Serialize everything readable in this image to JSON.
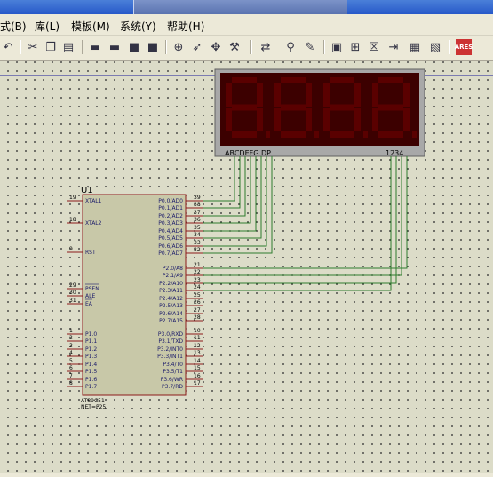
{
  "menu": [
    "式(B)",
    "库(L)",
    "模板(M)",
    "系统(Y)",
    "帮助(H)"
  ],
  "toolbar_icons": [
    "undo-icon",
    "cut-icon",
    "copy-icon",
    "paste-icon",
    "block-copy-icon",
    "block-move-icon",
    "block-rotate-icon",
    "block-delete-icon",
    "zoom-icon",
    "pick-device-icon",
    "make-device-icon",
    "packaging-tool-icon",
    "wire-autorouter-icon",
    "search-tag-icon",
    "property-assign-icon",
    "new-sheet-icon",
    "remove-sheet-icon",
    "goto-sheet-icon",
    "bom-icon",
    "netlist-icon",
    "ares-icon"
  ],
  "component": {
    "ref": "U1",
    "part": "AT89C51",
    "net_label": "NET=P25",
    "left_pins": [
      {
        "num": "19",
        "name": "XTAL1"
      },
      {
        "num": "18",
        "name": "XTAL2"
      },
      {
        "num": "9",
        "name": "RST"
      },
      {
        "num": "29",
        "name": "PSEN"
      },
      {
        "num": "30",
        "name": "ALE"
      },
      {
        "num": "31",
        "name": "EA"
      },
      {
        "num": "1",
        "name": "P1.0"
      },
      {
        "num": "2",
        "name": "P1.1"
      },
      {
        "num": "3",
        "name": "P1.2"
      },
      {
        "num": "4",
        "name": "P1.3"
      },
      {
        "num": "5",
        "name": "P1.4"
      },
      {
        "num": "6",
        "name": "P1.5"
      },
      {
        "num": "7",
        "name": "P1.6"
      },
      {
        "num": "8",
        "name": "P1.7"
      }
    ],
    "right_pins": [
      {
        "num": "39",
        "name": "P0.0/AD0"
      },
      {
        "num": "38",
        "name": "P0.1/AD1"
      },
      {
        "num": "37",
        "name": "P0.2/AD2"
      },
      {
        "num": "36",
        "name": "P0.3/AD3"
      },
      {
        "num": "35",
        "name": "P0.4/AD4"
      },
      {
        "num": "34",
        "name": "P0.5/AD5"
      },
      {
        "num": "33",
        "name": "P0.6/AD6"
      },
      {
        "num": "32",
        "name": "P0.7/AD7"
      },
      {
        "num": "21",
        "name": "P2.0/A8"
      },
      {
        "num": "22",
        "name": "P2.1/A9"
      },
      {
        "num": "23",
        "name": "P2.2/A10"
      },
      {
        "num": "24",
        "name": "P2.3/A11"
      },
      {
        "num": "25",
        "name": "P2.4/A12"
      },
      {
        "num": "26",
        "name": "P2.5/A13"
      },
      {
        "num": "27",
        "name": "P2.6/A14"
      },
      {
        "num": "28",
        "name": "P2.7/A15"
      },
      {
        "num": "10",
        "name": "P3.0/RXD"
      },
      {
        "num": "11",
        "name": "P3.1/TXD"
      },
      {
        "num": "12",
        "name": "P3.2/INT0"
      },
      {
        "num": "13",
        "name": "P3.3/INT1"
      },
      {
        "num": "14",
        "name": "P3.4/T0"
      },
      {
        "num": "15",
        "name": "P3.5/T1"
      },
      {
        "num": "16",
        "name": "P3.6/WR"
      },
      {
        "num": "17",
        "name": "P3.7/RD"
      }
    ]
  },
  "display": {
    "segment_label": "ABCDEFG DP",
    "digit_label": "1234",
    "digits": 4,
    "digit_value": "8",
    "segment_color": "#5a0000",
    "background_color": "#3c0000"
  },
  "colors": {
    "wire": "#2e7d2e",
    "pin": "#8b1a1a",
    "chip_fill": "#c8c8a8",
    "chip_border": "#8b1a1a",
    "text": "#1a1a6a"
  }
}
